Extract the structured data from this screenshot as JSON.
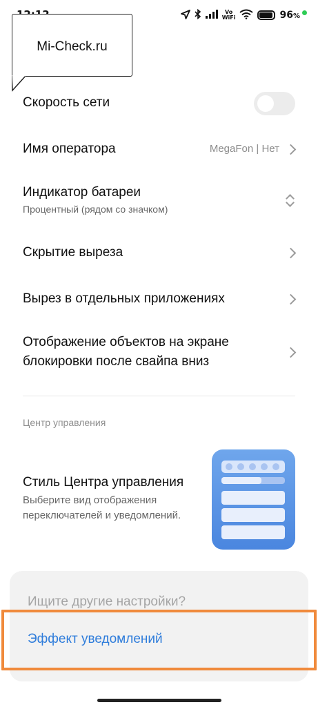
{
  "status_bar": {
    "time": "12:12",
    "volte_top": "Vo",
    "volte_bottom": "WiFi",
    "battery_percent": "96",
    "battery_suffix": "%",
    "battery_dot_color": "#2ecc55"
  },
  "watermark": {
    "text": "Mi-Check.ru"
  },
  "settings": {
    "network_speed": {
      "title": "Скорость сети",
      "enabled": false
    },
    "operator_name": {
      "title": "Имя оператора",
      "value": "MegaFon | Нет"
    },
    "battery_indicator": {
      "title": "Индикатор батареи",
      "subtitle": "Процентный (рядом со значком)"
    },
    "cutout_hiding": {
      "title": "Скрытие выреза"
    },
    "cutout_in_apps": {
      "title": "Вырез в отдельных приложениях"
    },
    "lockscreen_objects": {
      "title_line1": "Отображение объектов на экране",
      "title_line2": "блокировки после свайпа вниз"
    }
  },
  "control_center_section": {
    "header": "Центр управления",
    "style": {
      "title": "Стиль Центра управления",
      "subtitle_line1": "Выберите вид отображения",
      "subtitle_line2": "переключателей и уведомлений."
    }
  },
  "suggestions_card": {
    "title": "Ищите другие настройки?",
    "link": "Эффект уведомлений"
  },
  "colors": {
    "accent": "#2f7ddb",
    "highlight": "#f08a3c",
    "illustration": "#4a86df"
  }
}
